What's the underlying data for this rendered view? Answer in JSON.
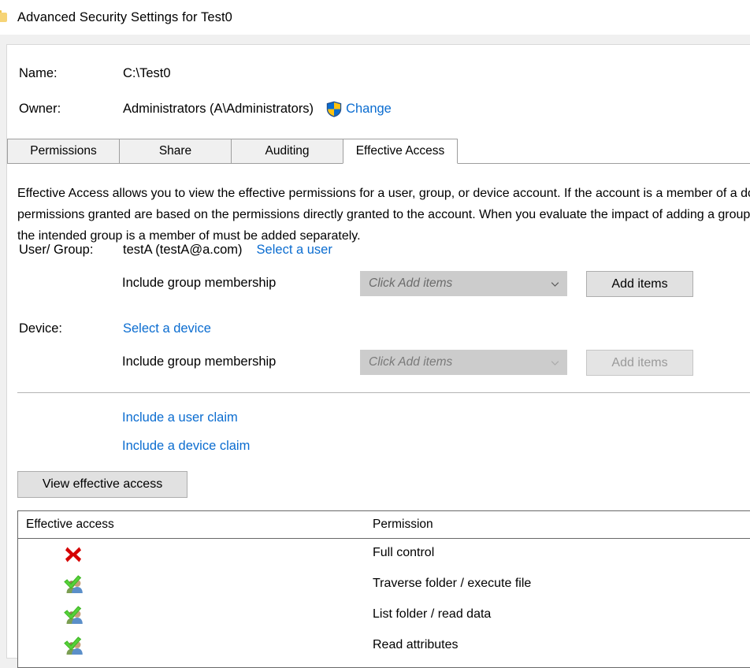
{
  "window": {
    "title": "Advanced Security Settings for Test0",
    "icon": "folder-icon"
  },
  "header": {
    "name_label": "Name:",
    "name_value": "C:\\Test0",
    "owner_label": "Owner:",
    "owner_value": "Administrators (A\\Administrators)",
    "change_link": "Change",
    "change_icon": "uac-shield-icon"
  },
  "tabs": [
    {
      "label": "Permissions",
      "active": false
    },
    {
      "label": "Share",
      "active": false
    },
    {
      "label": "Auditing",
      "active": false
    },
    {
      "label": "Effective Access",
      "active": true
    }
  ],
  "description": "Effective Access allows you to view the effective permissions for a user, group, or device account. If the account is a member of a domain, the permissions granted are based on the permissions directly granted to the account. When you evaluate the impact of adding a group, any group that the intended group is a member of must be added separately.",
  "form": {
    "user_group_label": "User/ Group:",
    "user_group_value": "testA (testA@a.com)",
    "select_user_link": "Select a user",
    "user_membership_label": "Include group membership",
    "user_membership_placeholder": "Click Add items",
    "user_add_items_button": "Add items",
    "device_label": "Device:",
    "select_device_link": "Select a device",
    "device_membership_label": "Include group membership",
    "device_membership_placeholder": "Click Add items",
    "device_add_items_button": "Add items",
    "include_user_claim_link": "Include a user claim",
    "include_device_claim_link": "Include a device claim",
    "view_effective_access_button": "View effective access"
  },
  "results": {
    "columns": [
      "Effective access",
      "Permission"
    ],
    "rows": [
      {
        "icon": "denied-red-x-icon",
        "permission": "Full control"
      },
      {
        "icon": "granted-green-check-users-icon",
        "permission": "Traverse folder / execute file"
      },
      {
        "icon": "granted-green-check-users-icon",
        "permission": "List folder / read data"
      },
      {
        "icon": "granted-green-check-users-icon",
        "permission": "Read attributes"
      }
    ]
  },
  "colors": {
    "link": "#0a6cd0",
    "denied": "#d50000",
    "granted": "#3cb521",
    "dialog_bg": "#f0f0f0",
    "panel_bg": "#ffffff",
    "control_bg": "#e1e1e1",
    "disabled_bg": "#cccccc"
  }
}
